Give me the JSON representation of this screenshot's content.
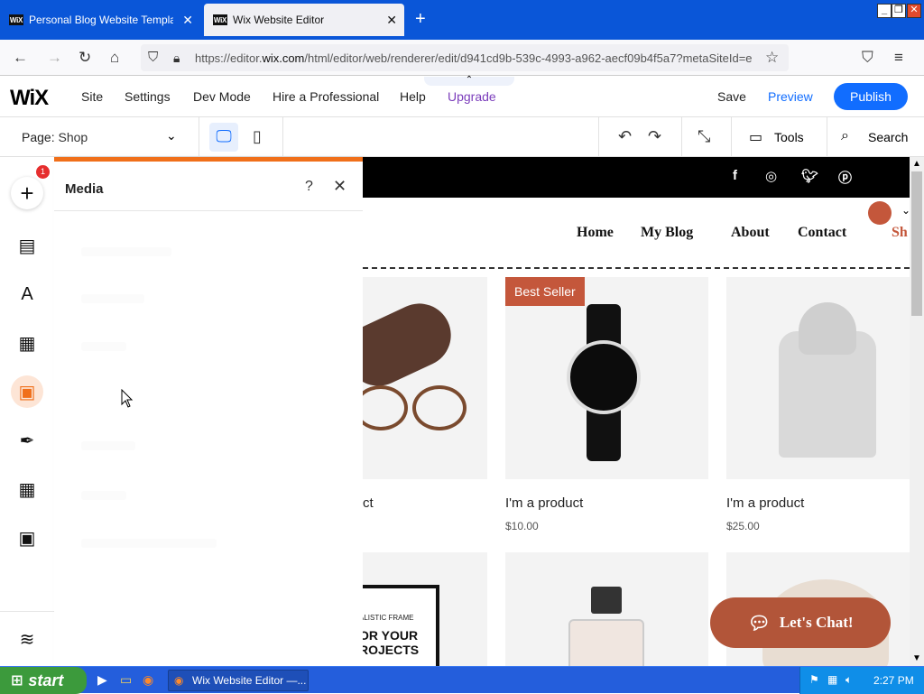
{
  "browser": {
    "tabs": [
      {
        "label": "Personal Blog Website Templates |",
        "favicon": "WiX"
      },
      {
        "label": "Wix Website Editor",
        "favicon": "WiX"
      }
    ],
    "url_prefix": "https://editor.",
    "url_domain": "wix.com",
    "url_rest": "/html/editor/web/renderer/edit/d941cd9b-539c-4993-a962-aecf09b4f5a7?metaSiteId=e"
  },
  "wix_top": {
    "logo": "WiX",
    "menu": [
      "Site",
      "Settings",
      "Dev Mode",
      "Hire a Professional",
      "Help",
      "Upgrade"
    ],
    "save": "Save",
    "preview": "Preview",
    "publish": "Publish"
  },
  "toolbar": {
    "page_label": "Page:",
    "page_value": "Shop",
    "tools": "Tools",
    "search": "Search"
  },
  "sidebar": {
    "apps_badge": "1"
  },
  "panel": {
    "title": "Media",
    "help": "?",
    "close": "✕"
  },
  "site": {
    "nav": [
      "Home",
      "My Blog",
      "About",
      "Contact",
      "Sh"
    ],
    "products": [
      {
        "name": "ct",
        "price": ""
      },
      {
        "name": "I'm a product",
        "price": "$10.00",
        "badge": "Best Seller"
      },
      {
        "name": "I'm a product",
        "price": "$25.00"
      }
    ],
    "frame_text_1": "ALISTIC FRAME",
    "frame_text_2": "OR YOUR",
    "frame_text_3": "ROJECTS",
    "chat": "Let's Chat!"
  },
  "taskbar": {
    "start": "start",
    "task": "Wix Website Editor —...",
    "clock": "2:27 PM"
  },
  "colors": {
    "publish": "#116dff",
    "upgrade": "#7b3dbb",
    "panel_accent": "#f06f1a",
    "chat": "#b25539",
    "badge": "#c4573b"
  }
}
